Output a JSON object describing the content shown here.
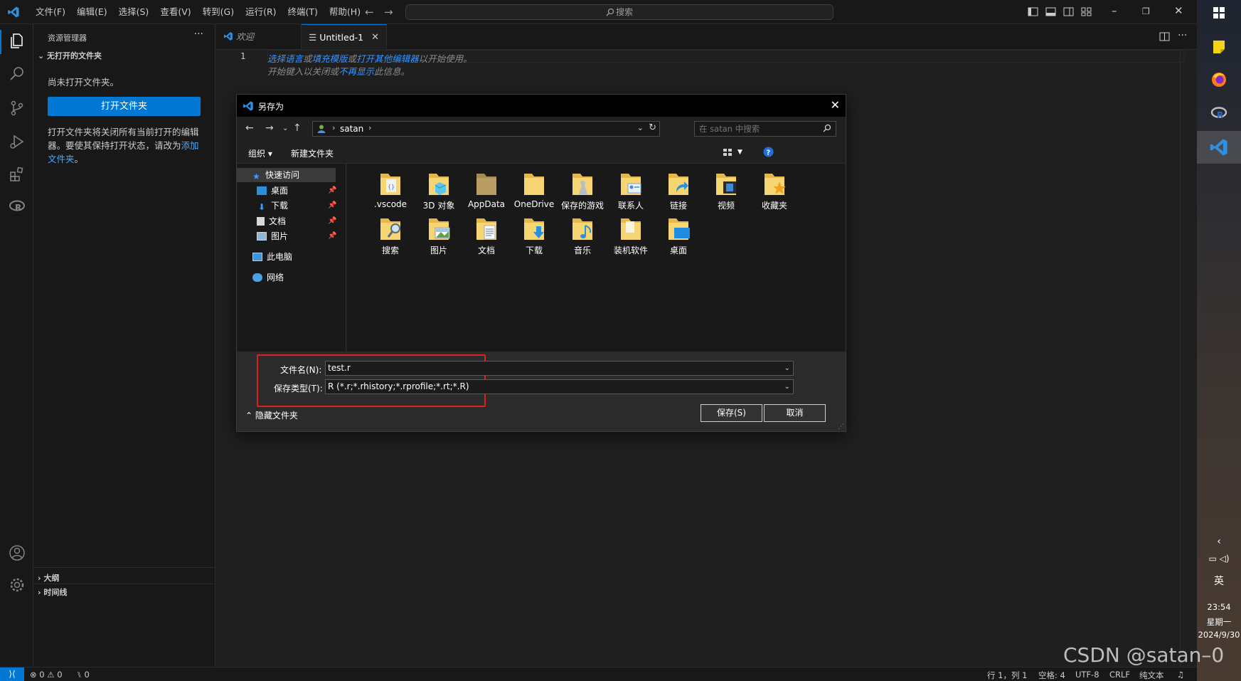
{
  "app": {
    "menu": [
      "文件(F)",
      "编辑(E)",
      "选择(S)",
      "查看(V)",
      "转到(G)",
      "运行(R)",
      "终端(T)",
      "帮助(H)"
    ],
    "search_placeholder": "搜索",
    "nav_back": "←",
    "nav_forward": "→"
  },
  "sidebar": {
    "title": "资源管理器",
    "more": "···",
    "section": "无打开的文件夹",
    "no_folder_text": "尚未打开文件夹。",
    "open_folder_button": "打开文件夹",
    "description": "打开文件夹将关闭所有当前打开的编辑器。要使其保持打开状态，请改为",
    "add_folder_link": "添加文件夹",
    "description_end": "。",
    "outline": "大纲",
    "timeline": "时间线"
  },
  "tabs": [
    {
      "label": "欢迎"
    },
    {
      "label": "Untitled-1",
      "close": "✕"
    }
  ],
  "editor": {
    "line_number": "1",
    "hint1_parts": [
      "选择语言",
      "或",
      "填充模版",
      "或",
      "打开其他编辑器",
      "以开始使用。"
    ],
    "hint2_parts": [
      "开始键入以关闭或",
      "不再显示",
      "此信息。"
    ]
  },
  "statusbar": {
    "problems": "⊗ 0 ⚠ 0",
    "ports": "⑊ 0",
    "position": "行 1，列 1",
    "spaces": "空格: 4",
    "encoding": "UTF-8",
    "eol": "CRLF",
    "language": "纯文本"
  },
  "dialog": {
    "title": "另存为",
    "address": "satan",
    "search_placeholder": "在 satan 中搜索",
    "organize": "组织 ▾",
    "new_folder": "新建文件夹",
    "nav": {
      "quick_access": "快速访问",
      "items": [
        "桌面",
        "下载",
        "文档",
        "图片"
      ],
      "this_pc": "此电脑",
      "network": "网络"
    },
    "files_row1": [
      ".vscode",
      "3D 对象",
      "AppData",
      "OneDrive",
      "保存的游戏",
      "联系人",
      "链接",
      "视频",
      "收藏夹"
    ],
    "files_row2": [
      "搜索",
      "图片",
      "文档",
      "下载",
      "音乐",
      "装机软件",
      "桌面"
    ],
    "filename_label": "文件名(N):",
    "filename_value": "test.r",
    "filetype_label": "保存类型(T):",
    "filetype_value": "R (*.r;*.rhistory;*.rprofile;*.rt;*.R)",
    "save_button": "保存(S)",
    "cancel_button": "取消",
    "hide_folders": "隐藏文件夹"
  },
  "taskbar": {
    "ime": "英",
    "time": "23:54",
    "weekday": "星期一",
    "date": "2024/9/30"
  },
  "watermark": "CSDN @satan–0",
  "colors": {
    "accent": "#0078d4",
    "highlight_box": "#e0201c",
    "link": "#4daafc"
  }
}
